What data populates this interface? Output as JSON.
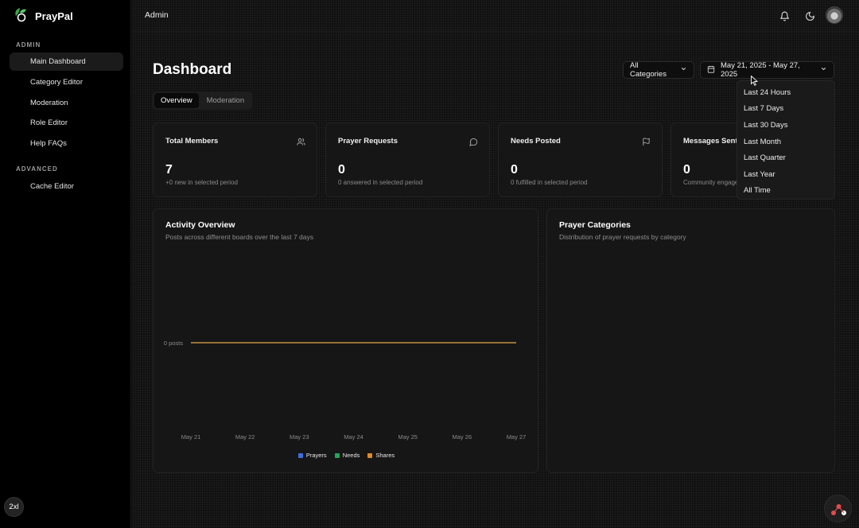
{
  "brand": {
    "name": "PrayPal"
  },
  "sidebar": {
    "sections": [
      {
        "label": "ADMIN",
        "items": [
          {
            "label": "Main Dashboard",
            "active": true
          },
          {
            "label": "Category Editor"
          },
          {
            "label": "Moderation"
          },
          {
            "label": "Role Editor"
          },
          {
            "label": "Help FAQs"
          }
        ]
      },
      {
        "label": "ADVANCED",
        "items": [
          {
            "label": "Cache Editor"
          }
        ]
      }
    ],
    "corner_badge": "2xl"
  },
  "topbar": {
    "title": "Admin",
    "icons": [
      "bell-icon",
      "theme-toggle-icon",
      "avatar"
    ]
  },
  "page": {
    "title": "Dashboard",
    "tabs": [
      {
        "label": "Overview",
        "active": true
      },
      {
        "label": "Moderation"
      }
    ],
    "category_filter": "All Categories",
    "date_range": "May 21, 2025 - May 27, 2025"
  },
  "stats": [
    {
      "title": "Total Members",
      "value": "7",
      "sub": "+0 new in selected period",
      "icon": "users-icon"
    },
    {
      "title": "Prayer Requests",
      "value": "0",
      "sub": "0 answered in selected period",
      "icon": "message-icon"
    },
    {
      "title": "Needs Posted",
      "value": "0",
      "sub": "0 fulfilled in selected period",
      "icon": "flag-icon"
    },
    {
      "title": "Messages Sent",
      "value": "0",
      "sub": "Community engage",
      "icon": "chat-icon"
    }
  ],
  "activity": {
    "title": "Activity Overview",
    "subtitle": "Posts across different boards over the last 7 days"
  },
  "categories_panel": {
    "title": "Prayer Categories",
    "subtitle": "Distribution of prayer requests by category"
  },
  "date_menu": {
    "options": [
      "Last 24 Hours",
      "Last 7 Days",
      "Last 30 Days",
      "Last Month",
      "Last Quarter",
      "Last Year",
      "All Time"
    ]
  },
  "chart_data": {
    "type": "line",
    "title": "Activity Overview",
    "x": [
      "May 21",
      "May 22",
      "May 23",
      "May 24",
      "May 25",
      "May 26",
      "May 27"
    ],
    "y_tick_labels": [
      "0 posts"
    ],
    "series": [
      {
        "name": "Prayers",
        "values": [
          0,
          0,
          0,
          0,
          0,
          0,
          0
        ],
        "color": "#3b6fe0"
      },
      {
        "name": "Needs",
        "values": [
          0,
          0,
          0,
          0,
          0,
          0,
          0
        ],
        "color": "#22a65a"
      },
      {
        "name": "Shares",
        "values": [
          0,
          0,
          0,
          0,
          0,
          0,
          0
        ],
        "color": "#e0892a"
      }
    ]
  }
}
